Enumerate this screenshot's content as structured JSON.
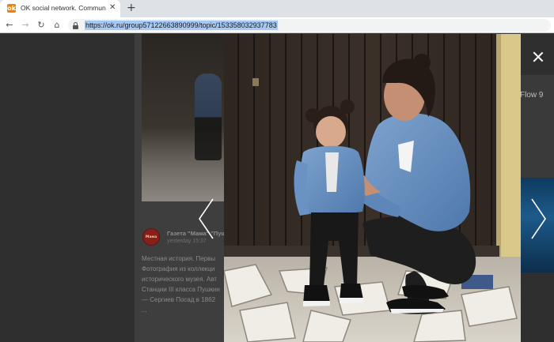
{
  "browser": {
    "tab_title": "OK social network. Communic",
    "tab_close": "✕",
    "new_tab": "+",
    "favicon": "ok-favicon",
    "url": "https://ok.ru/group57122663890999/topic/153358032937783",
    "nav": {
      "back": "←",
      "forward": "→",
      "reload": "↻",
      "home": "⌂"
    }
  },
  "page": {
    "post": {
      "avatar_text": "Мама",
      "author": "Газета \"Мама\" \"Пуш",
      "time": "yesterday 15:37",
      "text_lines": [
        "Местная история. Первы",
        "Фотография из коллекци",
        "исторического музея. Авт",
        "Станции III класса Пушкин",
        "— Сергиев Посад в 1862",
        "..."
      ]
    },
    "right_sidebar_text": "Flow 9"
  },
  "lightbox": {
    "close_icon": "close-icon",
    "prev_icon": "chevron-left-icon",
    "next_icon": "chevron-right-icon"
  }
}
